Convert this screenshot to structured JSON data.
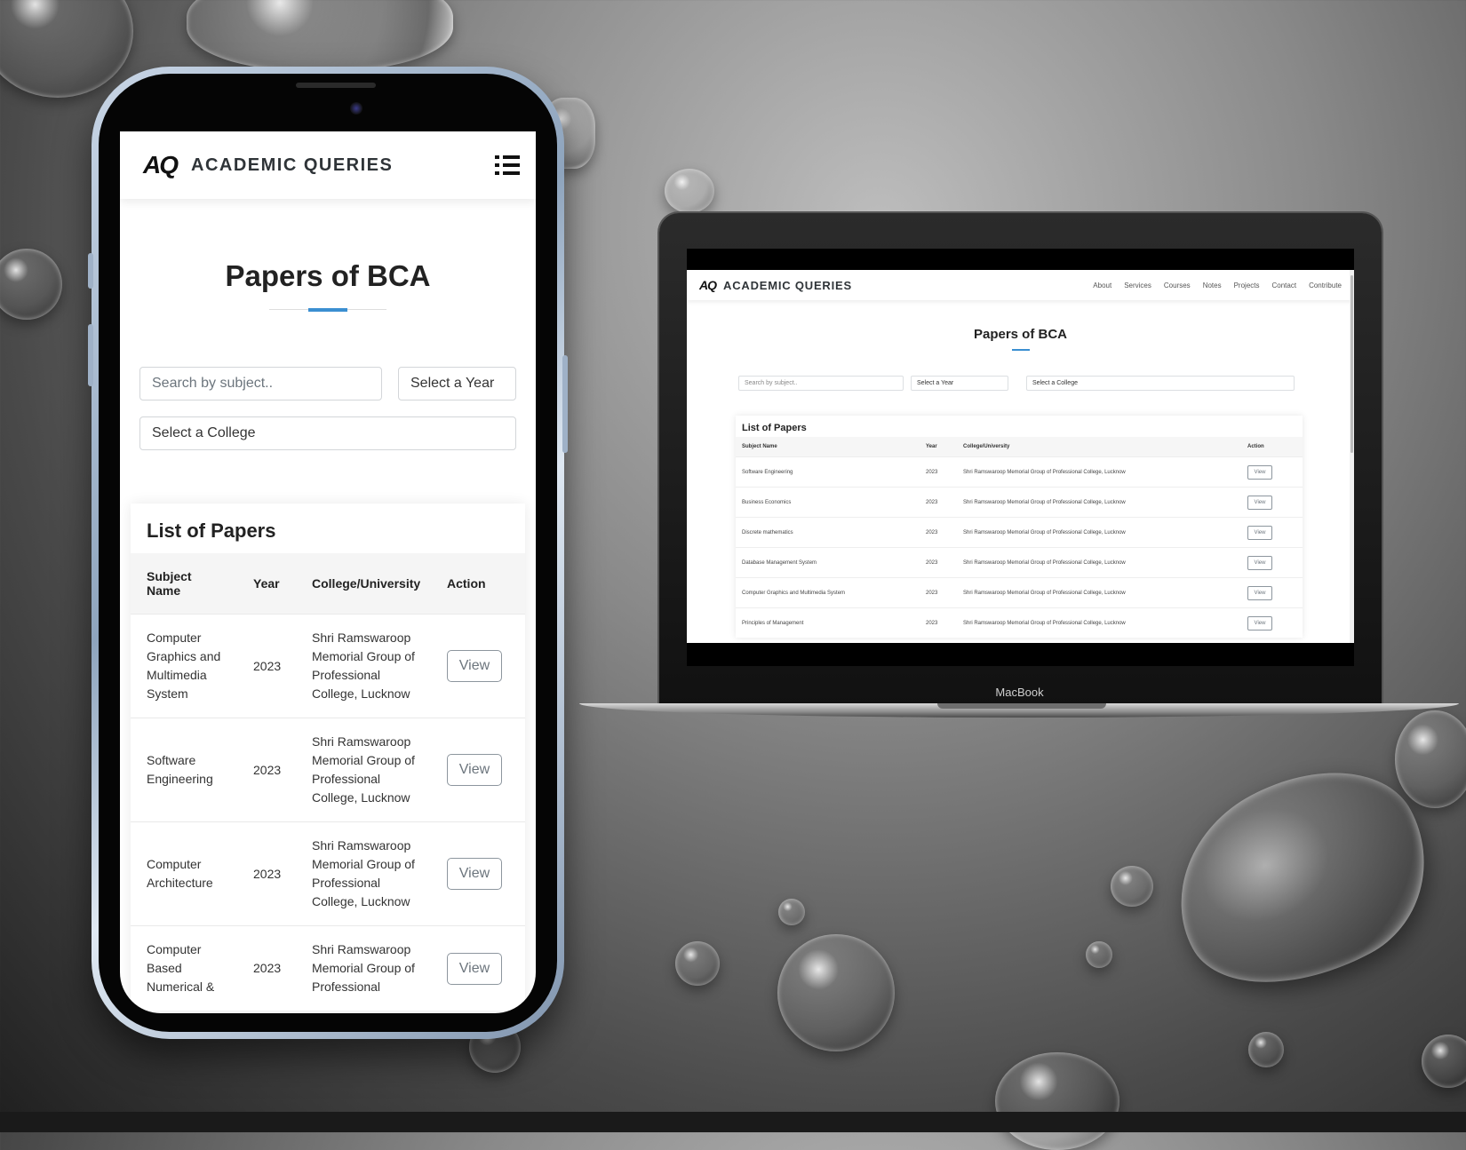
{
  "brand": {
    "logo_mark": "AQ",
    "name": "ACADEMIC QUERIES"
  },
  "page": {
    "title": "Papers of BCA"
  },
  "filters": {
    "search_placeholder": "Search by subject..",
    "year_label": "Select a Year",
    "college_label": "Select a College"
  },
  "nav_links": [
    "About",
    "Services",
    "Courses",
    "Notes",
    "Projects",
    "Contact",
    "Contribute"
  ],
  "table": {
    "title": "List of Papers",
    "columns": [
      "Subject Name",
      "Year",
      "College/University",
      "Action"
    ],
    "action_label": "View"
  },
  "mobile_rows": [
    {
      "subject": "Computer Graphics and Multimedia System",
      "year": "2023",
      "college": "Shri Ramswaroop Memorial Group of Professional College, Lucknow"
    },
    {
      "subject": "Software Engineering",
      "year": "2023",
      "college": "Shri Ramswaroop Memorial Group of Professional College, Lucknow"
    },
    {
      "subject": "Computer Architecture",
      "year": "2023",
      "college": "Shri Ramswaroop Memorial Group of Professional College, Lucknow"
    },
    {
      "subject": "Computer Based Numerical &",
      "year": "2023",
      "college": "Shri Ramswaroop Memorial Group of Professional"
    }
  ],
  "desktop_rows": [
    {
      "subject": "Software Engineering",
      "year": "2023",
      "college": "Shri Ramswaroop Memorial Group of Professional College, Lucknow"
    },
    {
      "subject": "Business Economics",
      "year": "2023",
      "college": "Shri Ramswaroop Memorial Group of Professional College, Lucknow"
    },
    {
      "subject": "Discrete mathematics",
      "year": "2023",
      "college": "Shri Ramswaroop Memorial Group of Professional College, Lucknow"
    },
    {
      "subject": "Database Management System",
      "year": "2023",
      "college": "Shri Ramswaroop Memorial Group of Professional College, Lucknow"
    },
    {
      "subject": "Computer Graphics and Multimedia System",
      "year": "2023",
      "college": "Shri Ramswaroop Memorial Group of Professional College, Lucknow"
    },
    {
      "subject": "Principles of Management",
      "year": "2023",
      "college": "Shri Ramswaroop Memorial Group of Professional College, Lucknow"
    }
  ],
  "device": {
    "laptop_label": "MacBook"
  },
  "colors": {
    "accent": "#3b8fd1",
    "text": "#222222",
    "button_border": "#8d969e"
  }
}
